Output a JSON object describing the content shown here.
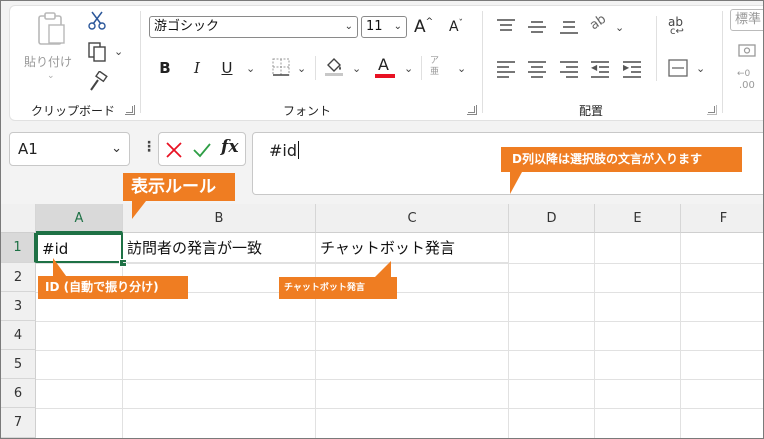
{
  "ribbon": {
    "clipboard": {
      "paste_label": "貼り付け",
      "group_label": "クリップボード"
    },
    "font": {
      "font_name": "游ゴシック",
      "font_size": "11",
      "grow_glyph": "A",
      "shrink_glyph": "A",
      "bold": "B",
      "italic": "I",
      "underline": "U",
      "font_color_glyph": "A",
      "font_color": "#e81123",
      "phonetic_glyph": "ア亜",
      "group_label": "フォント"
    },
    "alignment": {
      "wrap_glyph": "ab",
      "group_label": "配置"
    },
    "number": {
      "format_label": "標準",
      "decimal_glyph": ".00"
    }
  },
  "formula_bar": {
    "name_box": "A1",
    "fx_label": "fx",
    "content": "#id"
  },
  "grid": {
    "columns": [
      "A",
      "B",
      "C",
      "D",
      "E",
      "F"
    ],
    "rows": [
      "1",
      "2",
      "3",
      "4",
      "5",
      "6",
      "7"
    ],
    "cells": {
      "A1": "#id",
      "B1": "訪問者の発言が一致",
      "C1": "チャットボット発言"
    }
  },
  "callouts": {
    "display_rule": "表示ルール",
    "id_auto": "ID (自動で振り分け)",
    "chatbot": "チャットボット発言",
    "d_column": "D列以降は選択肢の文言が入ります"
  },
  "colors": {
    "callout": "#ef7d22",
    "selection": "#1e7145",
    "accent_red": "#e81123",
    "check_green": "#2e9e45"
  }
}
